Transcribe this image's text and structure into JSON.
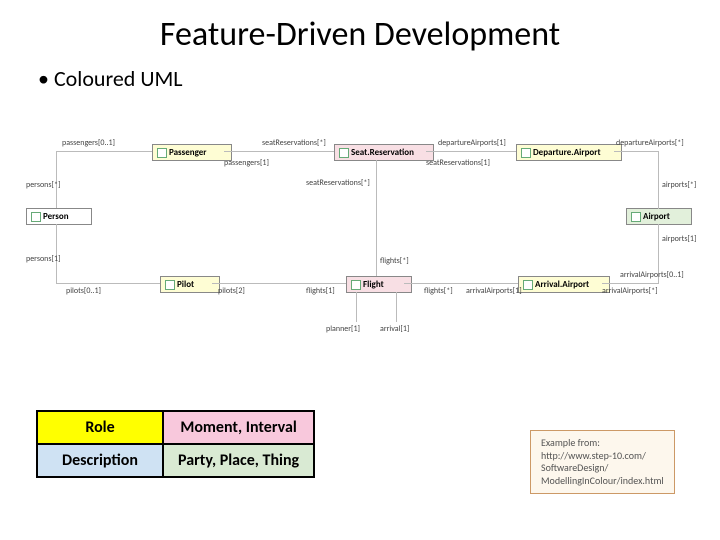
{
  "title": "Feature-Driven Development",
  "bullet": "Coloured UML",
  "classes": {
    "passenger": "Passenger",
    "seatRes": "Seat.Reservation",
    "depAirport": "Departure.Airport",
    "person": "Person",
    "pilot": "Pilot",
    "flight": "Flight",
    "arrAirport": "Arrival.Airport",
    "airport": "Airport"
  },
  "labels": {
    "passengers01": "passengers[0..1]",
    "passengers1": "passengers[1]",
    "seatResStar": "seatReservations[*]",
    "seatRes1": "seatReservations[1]",
    "depAirports1": "departureAirports[1]",
    "depAirportsStar": "departureAirports[*]",
    "personsStar": "persons[*]",
    "persons1": "persons[1]",
    "pilots01": "pilots[0..1]",
    "pilots2": "pilots[2]",
    "flights1": "flights[1]",
    "flightsStar": "flights[*]",
    "flightsStar2": "flights[*]",
    "arrAirports1": "arrivalAirports[1]",
    "arrAirportsStar": "arrivalAirports[*]",
    "arrAirports01": "arrivalAirports[0..1]",
    "airportsStar": "airports[*]",
    "airports1": "airports[1]",
    "planner1": "planner[1]",
    "arrival1": "arrival[1]"
  },
  "legend": {
    "role": "Role",
    "moment": "Moment, Interval",
    "desc": "Description",
    "party": "Party, Place, Thing"
  },
  "source": {
    "l1": "Example from:",
    "l2": "http://www.step-10.com/",
    "l3": "SoftwareDesign/",
    "l4": "ModellingInColour/index.html"
  }
}
